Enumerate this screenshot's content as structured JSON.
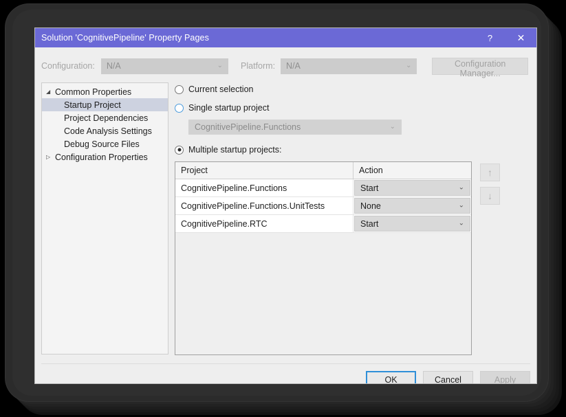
{
  "window": {
    "title": "Solution 'CognitivePipeline' Property Pages",
    "help_icon": "?",
    "close_icon": "✕",
    "titlebar_color": "#6b69d6"
  },
  "config_bar": {
    "configuration_label": "Configuration:",
    "configuration_value": "N/A",
    "platform_label": "Platform:",
    "platform_value": "N/A",
    "configuration_manager_label": "Configuration Manager...",
    "chevron_icon": "⌄"
  },
  "tree": {
    "items": [
      {
        "label": "Common Properties",
        "twisty": "◢",
        "level": 0,
        "selected": false
      },
      {
        "label": "Startup Project",
        "twisty": "",
        "level": 1,
        "selected": true
      },
      {
        "label": "Project Dependencies",
        "twisty": "",
        "level": 1,
        "selected": false
      },
      {
        "label": "Code Analysis Settings",
        "twisty": "",
        "level": 1,
        "selected": false
      },
      {
        "label": "Debug Source Files",
        "twisty": "",
        "level": 1,
        "selected": false
      },
      {
        "label": "Configuration Properties",
        "twisty": "▷",
        "level": 0,
        "selected": false
      }
    ]
  },
  "options": {
    "current_selection_label": "Current selection",
    "single_startup_label": "Single startup project",
    "single_startup_value": "CognitivePipeline.Functions",
    "multiple_startup_label": "Multiple startup projects:",
    "chevron_icon": "⌄"
  },
  "grid": {
    "columns": [
      "Project",
      "Action"
    ],
    "rows": [
      {
        "project": "CognitivePipeline.Functions",
        "action": "Start"
      },
      {
        "project": "CognitivePipeline.Functions.UnitTests",
        "action": "None"
      },
      {
        "project": "CognitivePipeline.RTC",
        "action": "Start"
      }
    ],
    "chevron_icon": "⌄"
  },
  "move_buttons": {
    "up_icon": "↑",
    "down_icon": "↓"
  },
  "footer": {
    "ok_label": "OK",
    "cancel_label": "Cancel",
    "apply_label": "Apply"
  }
}
